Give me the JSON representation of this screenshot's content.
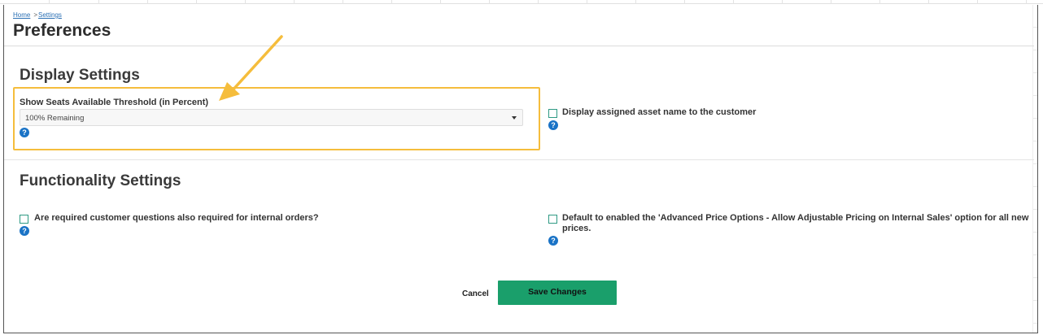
{
  "breadcrumb": {
    "home": "Home",
    "separator": ">",
    "current": "Settings"
  },
  "page": {
    "title": "Preferences"
  },
  "display_settings": {
    "title": "Display Settings",
    "seats_threshold": {
      "label": "Show Seats Available Threshold (in Percent)",
      "selected": "100% Remaining"
    },
    "asset_name": {
      "label": "Display assigned asset name to the customer",
      "checked": false
    }
  },
  "functionality_settings": {
    "title": "Functionality Settings",
    "required_questions": {
      "label": "Are required customer questions also required for internal orders?",
      "checked": false
    },
    "advanced_price": {
      "label": "Default to enabled the 'Advanced Price Options - Allow Adjustable Pricing on Internal Sales' option for all new prices.",
      "checked": false
    }
  },
  "help": {
    "glyph": "?"
  },
  "actions": {
    "cancel": "Cancel",
    "save": "Save Changes"
  },
  "colors": {
    "accent_box": "#f5bd3c",
    "save_button": "#1a9f6b",
    "checkbox": "#2f9a84",
    "help_icon": "#1a73c6",
    "link": "#2a6fb4"
  }
}
